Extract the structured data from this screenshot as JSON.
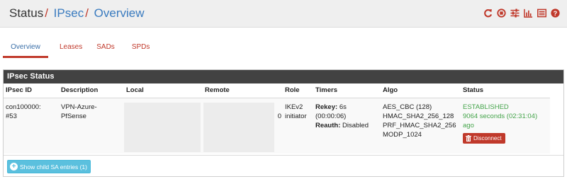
{
  "header": {
    "crumbs": [
      "Status",
      "IPsec",
      "Overview"
    ],
    "separator": "/",
    "icons": [
      "refresh-icon",
      "stop-service-icon",
      "sliders-icon",
      "chart-icon",
      "list-icon",
      "help-icon"
    ]
  },
  "tabs": [
    "Overview",
    "Leases",
    "SADs",
    "SPDs"
  ],
  "panel": {
    "title": "IPsec Status",
    "columns": [
      "IPsec ID",
      "Description",
      "Local",
      "Remote",
      "Role",
      "Timers",
      "Algo",
      "Status"
    ],
    "row": {
      "id": [
        "con100000:",
        "#53"
      ],
      "description": [
        "VPN-Azure-",
        "PfSense"
      ],
      "remote_fragment": "0",
      "role": [
        "IKEv2",
        "initiator"
      ],
      "timers": {
        "rekey_label": "Rekey:",
        "rekey_value": "6s",
        "rekey_paren": "(00:00:06)",
        "reauth_label": "Reauth:",
        "reauth_value": "Disabled"
      },
      "algo": [
        "AES_CBC (128)",
        "HMAC_SHA2_256_128",
        "PRF_HMAC_SHA2_256",
        "MODP_1024"
      ],
      "status": {
        "state": "ESTABLISHED",
        "uptime": "9064 seconds (02:31:04)",
        "uptime_suffix": "ago",
        "disconnect_label": "Disconnect"
      }
    },
    "footer": {
      "show_child_label": "Show child SA entries (1)"
    }
  },
  "colors": {
    "accent_red": "#c0392b",
    "link_blue": "#3a7bbf",
    "status_green": "#44a44a",
    "info_blue": "#5bc0de",
    "title_bar": "#424242"
  }
}
